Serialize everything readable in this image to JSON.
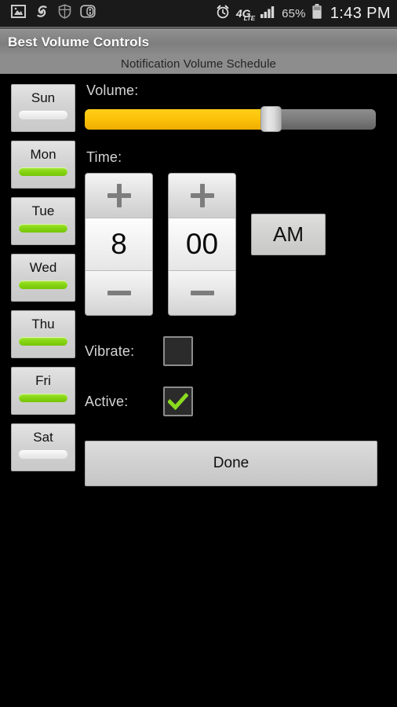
{
  "status_bar": {
    "left_icons": [
      "gallery-icon",
      "sync-icon",
      "shield-icon",
      "remote-icon"
    ],
    "alarm_icon": "alarm-clock-icon",
    "network_label": "4G",
    "network_sub": "LTE",
    "signal_icon": "signal-bars-icon",
    "battery_percent": "65%",
    "battery_icon": "battery-icon",
    "time": "1:43 PM"
  },
  "header": {
    "app_title": "Best Volume Controls",
    "screen_subtitle": "Notification Volume Schedule"
  },
  "days": [
    {
      "label": "Sun",
      "enabled": false
    },
    {
      "label": "Mon",
      "enabled": true
    },
    {
      "label": "Tue",
      "enabled": true
    },
    {
      "label": "Wed",
      "enabled": true
    },
    {
      "label": "Thu",
      "enabled": true
    },
    {
      "label": "Fri",
      "enabled": true
    },
    {
      "label": "Sat",
      "enabled": false
    }
  ],
  "volume": {
    "label": "Volume:",
    "percent": 65
  },
  "time_picker": {
    "label": "Time:",
    "hour": "8",
    "minute": "00",
    "meridiem": "AM",
    "increment_glyph": "plus-icon",
    "decrement_glyph": "minus-icon"
  },
  "vibrate": {
    "label": "Vibrate:",
    "checked": false
  },
  "active": {
    "label": "Active:",
    "checked": true
  },
  "done_button": {
    "label": "Done"
  },
  "colors": {
    "background": "#000000",
    "accent_yellow": "#fcc209",
    "accent_green": "#84d312",
    "title_bar": "#7e7e7e",
    "sub_bar": "#8d8d8d",
    "status_bar": "#1a1a1a",
    "button_face": "#d2d2d2"
  }
}
